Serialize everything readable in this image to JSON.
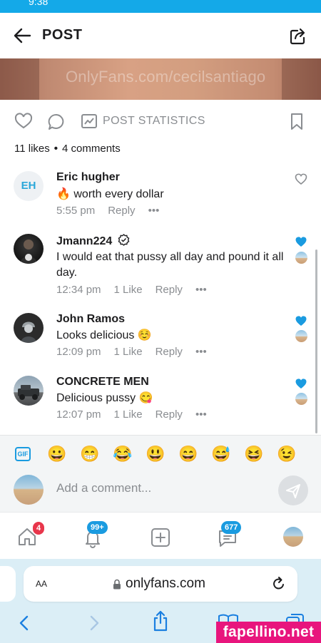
{
  "status_bar": {
    "time": "9:38"
  },
  "header": {
    "title": "POST",
    "back_icon": "arrow-left-icon",
    "share_icon": "share-icon"
  },
  "banner": {
    "watermark_text": "OnlyFans.com/cecilsantiago"
  },
  "post_actions": {
    "statistics_label": "POST STATISTICS",
    "icons": [
      "heart-icon",
      "comment-icon",
      "statistics-icon",
      "bookmark-icon"
    ]
  },
  "post_counts": {
    "likes": "11 likes",
    "separator": "•",
    "comments": "4 comments"
  },
  "comments": [
    {
      "initials": "EH",
      "name": "Eric hugher",
      "text": "🔥 worth every dollar",
      "time": "5:55 pm",
      "likes": "",
      "reply": "Reply",
      "liked": false
    },
    {
      "name": "Jmann224",
      "verified": true,
      "text": "I would eat that pussy all day and pound it all day.",
      "time": "12:34 pm",
      "likes": "1 Like",
      "reply": "Reply",
      "liked": true
    },
    {
      "name": "John Ramos",
      "text": "Looks delicious ☺️",
      "time": "12:09 pm",
      "likes": "1 Like",
      "reply": "Reply",
      "liked": true
    },
    {
      "name": "CONCRETE MEN",
      "text": "Delicious pussy 😋",
      "time": "12:07 pm",
      "likes": "1 Like",
      "reply": "Reply",
      "liked": true
    }
  ],
  "more_label": "•••",
  "emoji_bar": {
    "gif_label": "GIF",
    "emojis": [
      "😀",
      "😁",
      "😂",
      "😃",
      "😄",
      "😅",
      "😆",
      "😉"
    ]
  },
  "composer": {
    "placeholder": "Add a comment..."
  },
  "tab_bar": {
    "notifications_badge": "4",
    "bell_badge": "99+",
    "messages_badge": "677",
    "badge_colors": {
      "red": "#e8364b",
      "blue": "#1a9be0"
    }
  },
  "browser": {
    "text_size_label": "AA",
    "url": "onlyfans.com"
  },
  "corner_watermark": "fapellino.net",
  "colors": {
    "accent": "#1a9be0",
    "status_bar": "#14a9e8",
    "heart_liked": "#1a9be0",
    "muted": "#8a8d91"
  }
}
